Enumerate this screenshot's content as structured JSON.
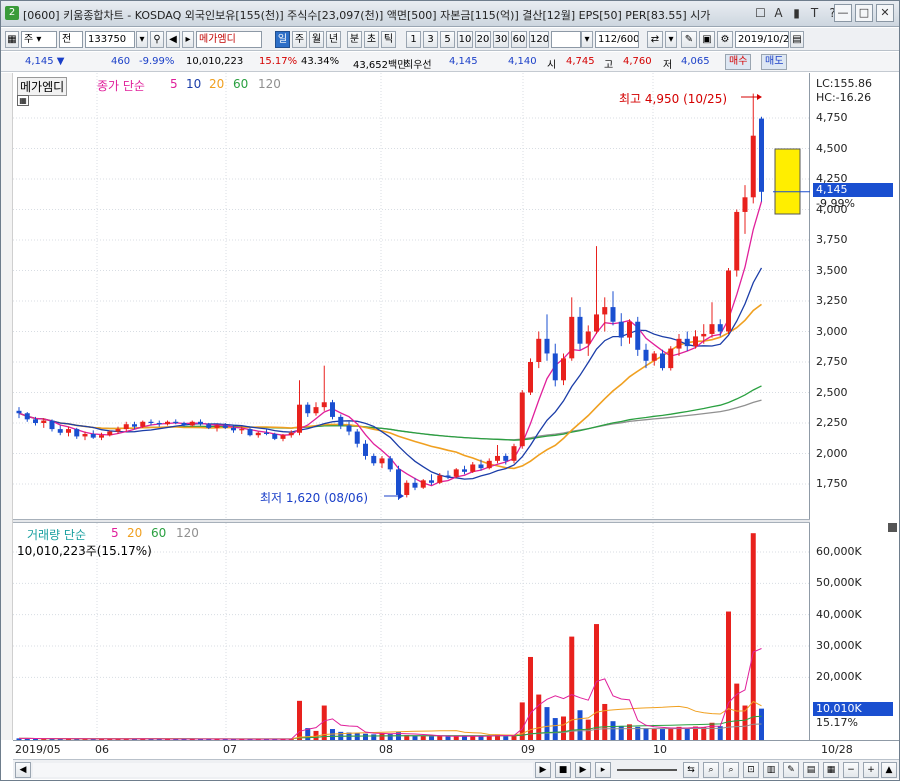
{
  "window": {
    "app_badge": "2",
    "title": "[0600] 키움종합차트 - KOSDAQ 외국인보유[155(천)] 주식수[23,097(천)] 액면[500] 자본금[115(억)] 결산[12월] EPS[50] PER[83.55] 시가",
    "title_icons": [
      "window-restore-icon",
      "font-size-icon",
      "pin-icon",
      "T",
      "help-icon"
    ],
    "title_icon_labels": [
      "☐",
      "A",
      "▮",
      "T",
      "?"
    ],
    "btn_min": "—",
    "btn_max": "□",
    "btn_close": "✕"
  },
  "toolbar": {
    "period_type": "주",
    "view_type": "전",
    "code": "133750",
    "name": "메가엠디",
    "periods": [
      "일",
      "주",
      "월",
      "년",
      "분",
      "초",
      "틱"
    ],
    "selected_period": "일",
    "intervals": [
      "1",
      "3",
      "5",
      "10",
      "20",
      "30",
      "60",
      "120"
    ],
    "count": "112/600",
    "date": "2019/10/28"
  },
  "price_info": {
    "price": "4,145 ▼",
    "change": "460",
    "change_pct": "-9.99%",
    "volume": "10,010,223",
    "volume_pct": "15.17%",
    "weight": "43.34%",
    "trade_value": "43,652백만",
    "best_ask_label": "최우선",
    "best_ask": "4,145",
    "best_bid": "4,140",
    "open_label": "시",
    "open": "4,745",
    "high_label": "고",
    "high": "4,760",
    "low_label": "저",
    "low": "4,065",
    "buy_btn": "매수",
    "sell_btn": "매도"
  },
  "price_pane": {
    "stock_label": "메가엠디",
    "legend_title": "종가 단순",
    "ma_periods": [
      "5",
      "10",
      "20",
      "60",
      "120"
    ],
    "lc": "LC:155.86",
    "hc": "HC:-16.26",
    "current_price": "4,145",
    "current_pct": "-9.99%",
    "high_note": "최고 4,950 (10/25)",
    "low_note": "최저 1,620 (08/06)",
    "y_ticks": [
      "4,750",
      "4,500",
      "4,250",
      "4,000",
      "3,750",
      "3,500",
      "3,250",
      "3,000",
      "2,750",
      "2,500",
      "2,250",
      "2,000",
      "1,750"
    ]
  },
  "volume_pane": {
    "legend_title": "거래량 단순",
    "ma_periods": [
      "5",
      "20",
      "60",
      "120"
    ],
    "current_volume": "10,010,223주(15.17%)",
    "current_box": "10,010K",
    "current_pct": "15.17%",
    "y_ticks": [
      "60,000K",
      "50,000K",
      "40,000K",
      "30,000K",
      "20,000K"
    ]
  },
  "date_axis": {
    "labels": [
      "2019/05",
      "06",
      "07",
      "08",
      "09",
      "10"
    ],
    "right_label": "10/28"
  },
  "colors": {
    "up": "#e8211d",
    "down": "#1a4fd0",
    "ma5": "#e0209b",
    "ma10": "#1b3da8",
    "ma20": "#f0a020",
    "ma60": "#2aa040",
    "ma120": "#909090"
  },
  "chart_data": {
    "type": "candlestick",
    "x_start": "2019-05-20",
    "y_range": [
      1500,
      4950
    ],
    "candles": [
      [
        2350,
        2380,
        2290,
        2330
      ],
      [
        2330,
        2340,
        2260,
        2280
      ],
      [
        2280,
        2300,
        2230,
        2250
      ],
      [
        2250,
        2290,
        2210,
        2270
      ],
      [
        2270,
        2280,
        2180,
        2200
      ],
      [
        2200,
        2230,
        2150,
        2170
      ],
      [
        2170,
        2220,
        2140,
        2200
      ],
      [
        2200,
        2210,
        2120,
        2140
      ],
      [
        2140,
        2180,
        2110,
        2160
      ],
      [
        2160,
        2190,
        2120,
        2130
      ],
      [
        2130,
        2170,
        2110,
        2150
      ],
      [
        2150,
        2190,
        2140,
        2180
      ],
      [
        2180,
        2220,
        2160,
        2200
      ],
      [
        2200,
        2260,
        2180,
        2240
      ],
      [
        2240,
        2260,
        2200,
        2220
      ],
      [
        2220,
        2270,
        2210,
        2260
      ],
      [
        2260,
        2280,
        2230,
        2250
      ],
      [
        2250,
        2270,
        2220,
        2240
      ],
      [
        2240,
        2270,
        2230,
        2260
      ],
      [
        2260,
        2280,
        2240,
        2250
      ],
      [
        2250,
        2260,
        2220,
        2230
      ],
      [
        2230,
        2270,
        2220,
        2260
      ],
      [
        2260,
        2280,
        2230,
        2240
      ],
      [
        2240,
        2250,
        2200,
        2210
      ],
      [
        2210,
        2240,
        2180,
        2230
      ],
      [
        2230,
        2250,
        2200,
        2210
      ],
      [
        2210,
        2230,
        2170,
        2190
      ],
      [
        2190,
        2220,
        2160,
        2200
      ],
      [
        2200,
        2210,
        2140,
        2150
      ],
      [
        2150,
        2180,
        2130,
        2170
      ],
      [
        2170,
        2200,
        2150,
        2160
      ],
      [
        2160,
        2170,
        2110,
        2120
      ],
      [
        2120,
        2160,
        2100,
        2150
      ],
      [
        2150,
        2190,
        2130,
        2170
      ],
      [
        2170,
        2600,
        2150,
        2400
      ],
      [
        2400,
        2420,
        2300,
        2330
      ],
      [
        2330,
        2420,
        2310,
        2380
      ],
      [
        2380,
        2720,
        2350,
        2420
      ],
      [
        2420,
        2440,
        2280,
        2300
      ],
      [
        2300,
        2320,
        2200,
        2230
      ],
      [
        2230,
        2260,
        2150,
        2180
      ],
      [
        2180,
        2200,
        2050,
        2080
      ],
      [
        2080,
        2110,
        1950,
        1980
      ],
      [
        1980,
        2000,
        1900,
        1920
      ],
      [
        1920,
        1980,
        1880,
        1960
      ],
      [
        1960,
        1980,
        1850,
        1870
      ],
      [
        1870,
        1900,
        1620,
        1660
      ],
      [
        1660,
        1780,
        1640,
        1760
      ],
      [
        1760,
        1800,
        1700,
        1720
      ],
      [
        1720,
        1790,
        1710,
        1780
      ],
      [
        1780,
        1830,
        1740,
        1760
      ],
      [
        1760,
        1840,
        1750,
        1820
      ],
      [
        1820,
        1860,
        1790,
        1810
      ],
      [
        1810,
        1880,
        1800,
        1870
      ],
      [
        1870,
        1900,
        1830,
        1850
      ],
      [
        1850,
        1930,
        1840,
        1910
      ],
      [
        1910,
        1950,
        1860,
        1880
      ],
      [
        1880,
        1960,
        1870,
        1940
      ],
      [
        1940,
        2070,
        1920,
        1980
      ],
      [
        1980,
        2000,
        1910,
        1940
      ],
      [
        1940,
        2080,
        1920,
        2060
      ],
      [
        2060,
        2520,
        2040,
        2500
      ],
      [
        2500,
        2780,
        2480,
        2750
      ],
      [
        2750,
        3000,
        2700,
        2940
      ],
      [
        2940,
        3140,
        2760,
        2820
      ],
      [
        2820,
        2900,
        2550,
        2600
      ],
      [
        2600,
        2820,
        2560,
        2780
      ],
      [
        2780,
        3280,
        2760,
        3120
      ],
      [
        3120,
        3200,
        2850,
        2900
      ],
      [
        2900,
        3050,
        2800,
        3000
      ],
      [
        3000,
        3700,
        2980,
        3140
      ],
      [
        3140,
        3280,
        3000,
        3200
      ],
      [
        3200,
        3330,
        3050,
        3080
      ],
      [
        3080,
        3150,
        2880,
        2950
      ],
      [
        2950,
        3100,
        2900,
        3080
      ],
      [
        3080,
        3120,
        2800,
        2850
      ],
      [
        2850,
        2900,
        2700,
        2760
      ],
      [
        2760,
        2840,
        2720,
        2820
      ],
      [
        2820,
        2850,
        2680,
        2700
      ],
      [
        2700,
        2880,
        2680,
        2860
      ],
      [
        2860,
        2980,
        2800,
        2940
      ],
      [
        2940,
        3000,
        2840,
        2880
      ],
      [
        2880,
        3010,
        2860,
        2960
      ],
      [
        2960,
        3060,
        2900,
        2980
      ],
      [
        2980,
        3240,
        2950,
        3060
      ],
      [
        3060,
        3100,
        2960,
        3000
      ],
      [
        3000,
        3520,
        2980,
        3500
      ],
      [
        3500,
        4000,
        3450,
        3980
      ],
      [
        3980,
        4200,
        3800,
        4100
      ],
      [
        4100,
        4950,
        4050,
        4605
      ],
      [
        4745,
        4760,
        4065,
        4145
      ]
    ],
    "volumes_k": [
      520,
      480,
      450,
      400,
      430,
      380,
      360,
      410,
      350,
      330,
      300,
      360,
      380,
      420,
      350,
      340,
      320,
      300,
      340,
      310,
      300,
      320,
      290,
      310,
      330,
      300,
      280,
      290,
      310,
      270,
      290,
      300,
      280,
      320,
      12500,
      3800,
      2900,
      11000,
      3500,
      2600,
      2400,
      2200,
      2000,
      1800,
      2100,
      1900,
      2500,
      1600,
      1400,
      1300,
      1200,
      1250,
      1100,
      1150,
      1200,
      1300,
      1250,
      1400,
      1800,
      1200,
      1500,
      12000,
      26500,
      14500,
      10500,
      7000,
      7500,
      33000,
      9500,
      6500,
      37000,
      11500,
      6000,
      4500,
      5000,
      4200,
      3800,
      3600,
      3500,
      4000,
      4200,
      3900,
      4300,
      4100,
      5500,
      4400,
      41000,
      18000,
      11000,
      66000,
      10010
    ]
  }
}
